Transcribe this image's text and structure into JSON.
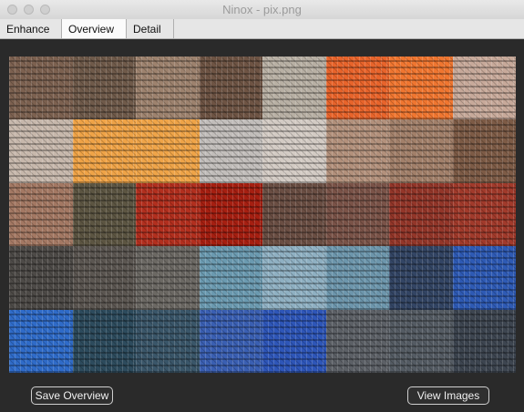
{
  "window": {
    "title": "Ninox - pix.png"
  },
  "tabs": [
    {
      "label": "Enhance",
      "active": false
    },
    {
      "label": "Overview",
      "active": true
    },
    {
      "label": "Detail",
      "active": false
    }
  ],
  "buttons": {
    "save_overview": "Save Overview",
    "view_images": "View Images"
  },
  "overview_tiles": [
    "#7c6150",
    "#6f5a4a",
    "#9d826e",
    "#6e5444",
    "#b8b0a4",
    "#e8642b",
    "#f07630",
    "#c7a99a",
    "#c7b8ac",
    "#efa347",
    "#efa448",
    "#c2bebb",
    "#d3cbc4",
    "#b3917c",
    "#a2806a",
    "#7d5b46",
    "#a37863",
    "#5c5542",
    "#b22f1e",
    "#a61f11",
    "#6a4e43",
    "#7a5348",
    "#933629",
    "#a13a2b",
    "#4d4a47",
    "#5b5651",
    "#6b6863",
    "#6b9ab0",
    "#8fb0c2",
    "#6d96ac",
    "#334564",
    "#2e5ab4",
    "#2f6bc8",
    "#2d4b5d",
    "#3a5669",
    "#3a5fb2",
    "#2e56b8",
    "#5c6066",
    "#545b63",
    "#3d4550"
  ]
}
